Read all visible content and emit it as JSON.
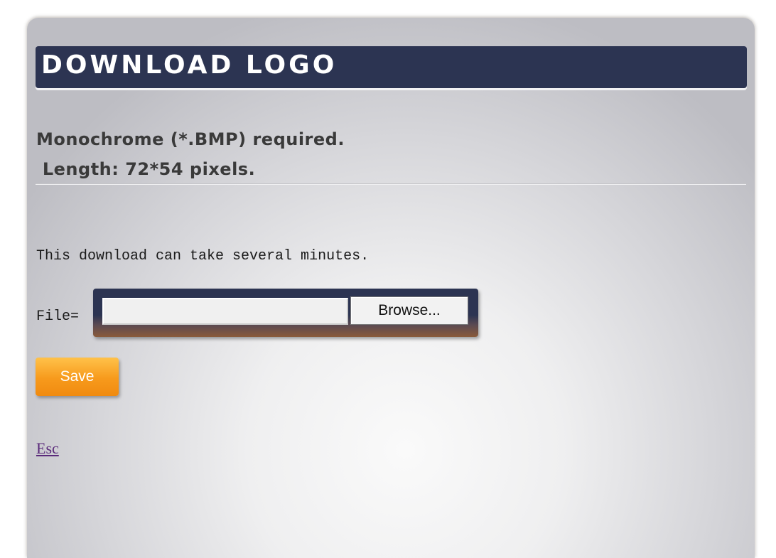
{
  "header": {
    "title": "DOWNLOAD LOGO"
  },
  "requirements": {
    "line1": "Monochrome (*.BMP) required.",
    "line2": " Length: 72*54 pixels."
  },
  "note": "This download can take several minutes.",
  "file": {
    "label": "File=",
    "value": "",
    "browse_label": "Browse..."
  },
  "actions": {
    "save_label": "Save",
    "esc_label": "Esc"
  },
  "colors": {
    "title_bar": "#2c3452",
    "save_button": "#f79a1c",
    "link": "#5a2a7a"
  }
}
